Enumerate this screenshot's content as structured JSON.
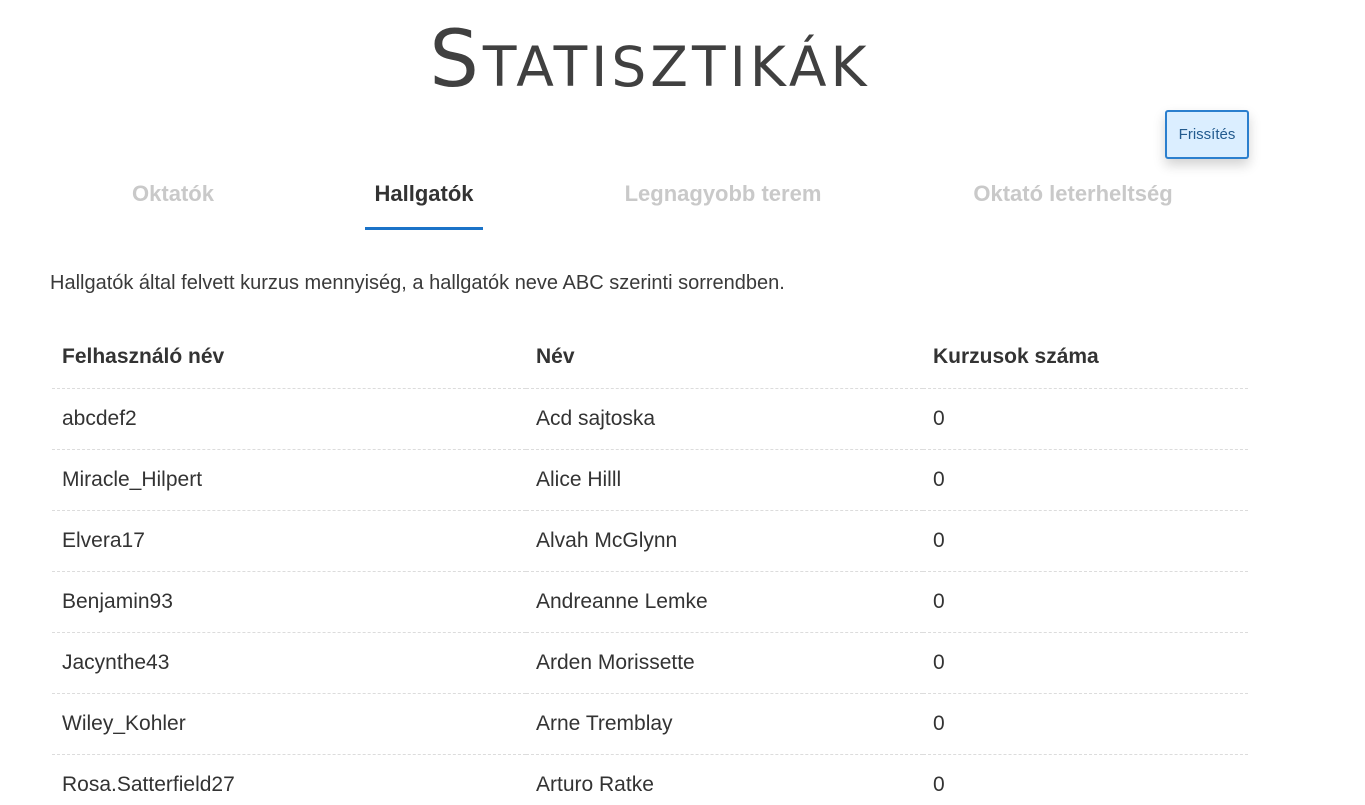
{
  "page": {
    "title": "Statisztikák"
  },
  "toolbar": {
    "refresh_label": "Frissítés"
  },
  "tabs": [
    {
      "label": "Oktatók",
      "active": false
    },
    {
      "label": "Hallgatók",
      "active": true
    },
    {
      "label": "Legnagyobb terem",
      "active": false
    },
    {
      "label": "Oktató leterheltség",
      "active": false
    }
  ],
  "content": {
    "description": "Hallgatók által felvett kurzus mennyiség, a hallgatók neve ABC szerinti sorrendben."
  },
  "table": {
    "headers": {
      "username": "Felhasználó név",
      "name": "Név",
      "course_count": "Kurzusok száma"
    },
    "rows": [
      {
        "username": "abcdef2",
        "name": "Acd sajtoska",
        "course_count": "0"
      },
      {
        "username": "Miracle_Hilpert",
        "name": "Alice Hilll",
        "course_count": "0"
      },
      {
        "username": "Elvera17",
        "name": "Alvah McGlynn",
        "course_count": "0"
      },
      {
        "username": "Benjamin93",
        "name": "Andreanne Lemke",
        "course_count": "0"
      },
      {
        "username": "Jacynthe43",
        "name": "Arden Morissette",
        "course_count": "0"
      },
      {
        "username": "Wiley_Kohler",
        "name": "Arne Tremblay",
        "course_count": "0"
      },
      {
        "username": "Rosa.Satterfield27",
        "name": "Arturo Ratke",
        "course_count": "0"
      }
    ]
  },
  "colors": {
    "accent": "#1b73c8",
    "button_bg": "#dbeeff",
    "inactive_tab": "#c9c9c9",
    "text": "#333333"
  }
}
